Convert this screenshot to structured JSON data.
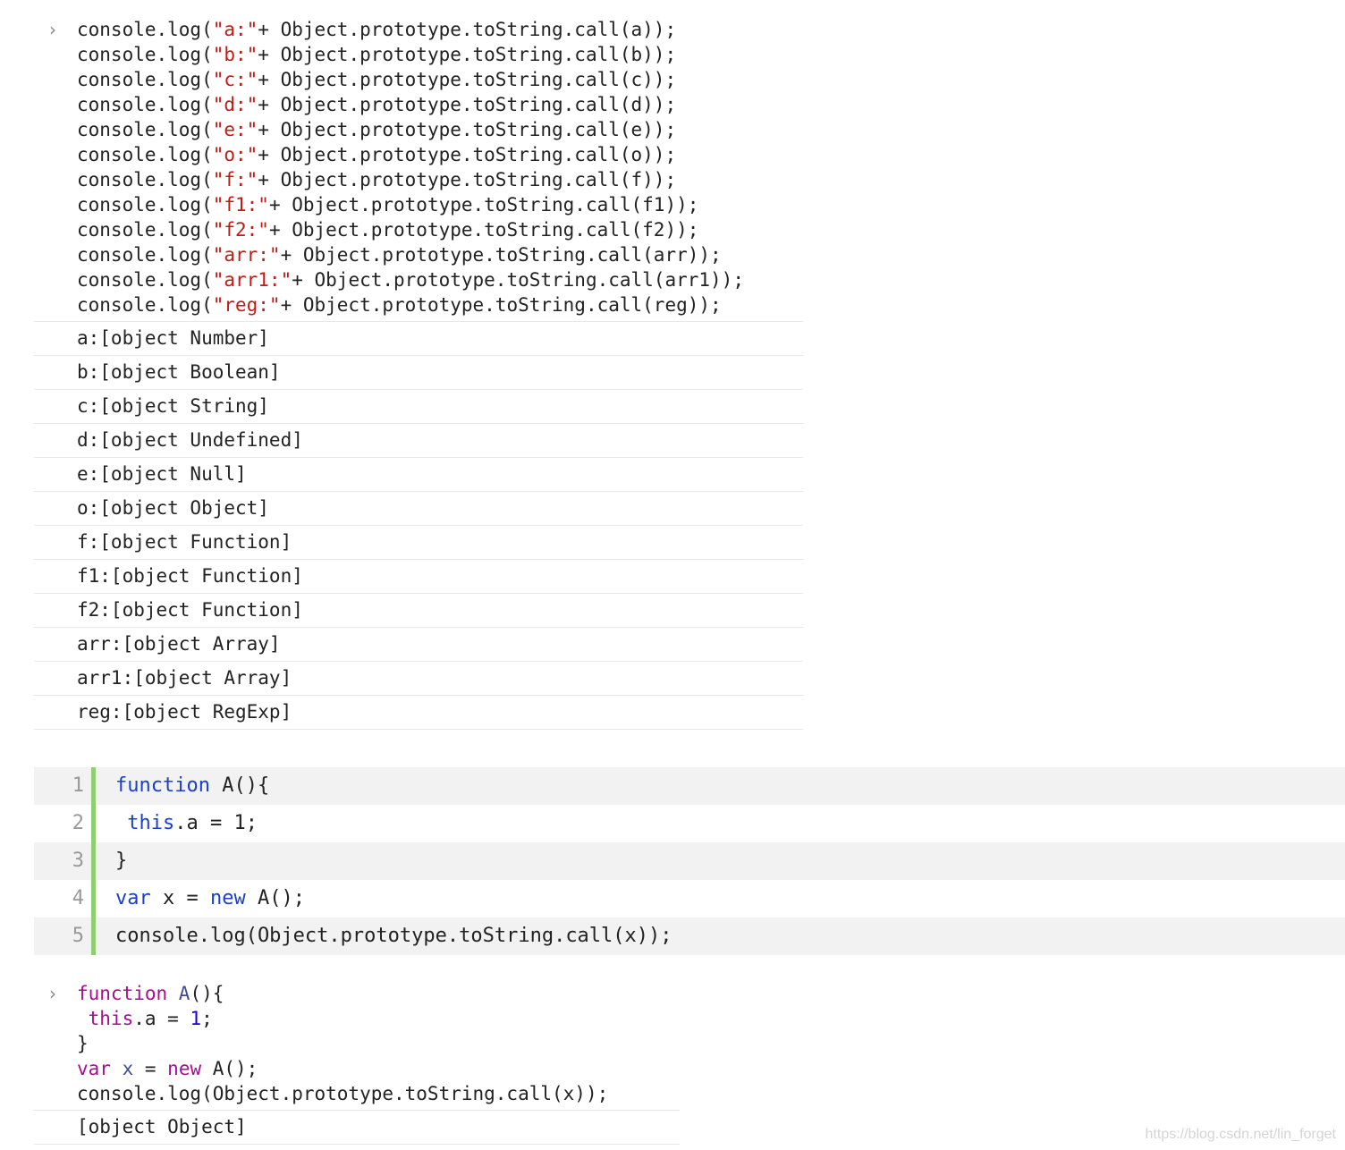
{
  "prompt_glyph": "›",
  "console1": {
    "input": [
      {
        "prefix": "console.log(",
        "str": "\"a:\"",
        "suffix": "+ Object.prototype.toString.call(a));"
      },
      {
        "prefix": "console.log(",
        "str": "\"b:\"",
        "suffix": "+ Object.prototype.toString.call(b));"
      },
      {
        "prefix": "console.log(",
        "str": "\"c:\"",
        "suffix": "+ Object.prototype.toString.call(c));"
      },
      {
        "prefix": "console.log(",
        "str": "\"d:\"",
        "suffix": "+ Object.prototype.toString.call(d));"
      },
      {
        "prefix": "console.log(",
        "str": "\"e:\"",
        "suffix": "+ Object.prototype.toString.call(e));"
      },
      {
        "prefix": "console.log(",
        "str": "\"o:\"",
        "suffix": "+ Object.prototype.toString.call(o));"
      },
      {
        "prefix": "console.log(",
        "str": "\"f:\"",
        "suffix": "+ Object.prototype.toString.call(f));"
      },
      {
        "prefix": "console.log(",
        "str": "\"f1:\"",
        "suffix": "+ Object.prototype.toString.call(f1));"
      },
      {
        "prefix": "console.log(",
        "str": "\"f2:\"",
        "suffix": "+ Object.prototype.toString.call(f2));"
      },
      {
        "prefix": "console.log(",
        "str": "\"arr:\"",
        "suffix": "+ Object.prototype.toString.call(arr));"
      },
      {
        "prefix": "console.log(",
        "str": "\"arr1:\"",
        "suffix": "+ Object.prototype.toString.call(arr1));"
      },
      {
        "prefix": "console.log(",
        "str": "\"reg:\"",
        "suffix": "+ Object.prototype.toString.call(reg));"
      }
    ],
    "output": [
      "a:[object Number]",
      "b:[object Boolean]",
      "c:[object String]",
      "d:[object Undefined]",
      "e:[object Null]",
      "o:[object Object]",
      "f:[object Function]",
      "f1:[object Function]",
      "f2:[object Function]",
      "arr:[object Array]",
      "arr1:[object Array]",
      "reg:[object RegExp]"
    ]
  },
  "code_block": {
    "lines": [
      {
        "num": "1",
        "kw": "function",
        "rest": " A(){"
      },
      {
        "num": "2",
        "kw": " this",
        "rest": ".a = 1;"
      },
      {
        "num": "3",
        "kw": "",
        "rest": "}"
      },
      {
        "num": "4",
        "kw": "var",
        "rest": " x = new A();"
      },
      {
        "num": "5",
        "kw": "",
        "rest": "console.log(Object.prototype.toString.call(x));"
      }
    ],
    "new_keyword": "new"
  },
  "console2": {
    "line1_kw": "function",
    "line1_name": " A",
    "line1_rest": "(){",
    "line2_kw": " this",
    "line2_mid": ".a = ",
    "line2_num": "1",
    "line2_end": ";",
    "line3": "}",
    "line4_kw": "var",
    "line4_var": " x",
    "line4_eq": " = ",
    "line4_new": "new",
    "line4_rest": " A();",
    "line5": "console.log(Object.prototype.toString.call(x));",
    "output": "[object Object]"
  },
  "watermark": "https://blog.csdn.net/lin_forget",
  "colors": {
    "string": "#c41a16",
    "keyword": "#aa0d91",
    "gutter_bar": "#8fcf6f"
  }
}
